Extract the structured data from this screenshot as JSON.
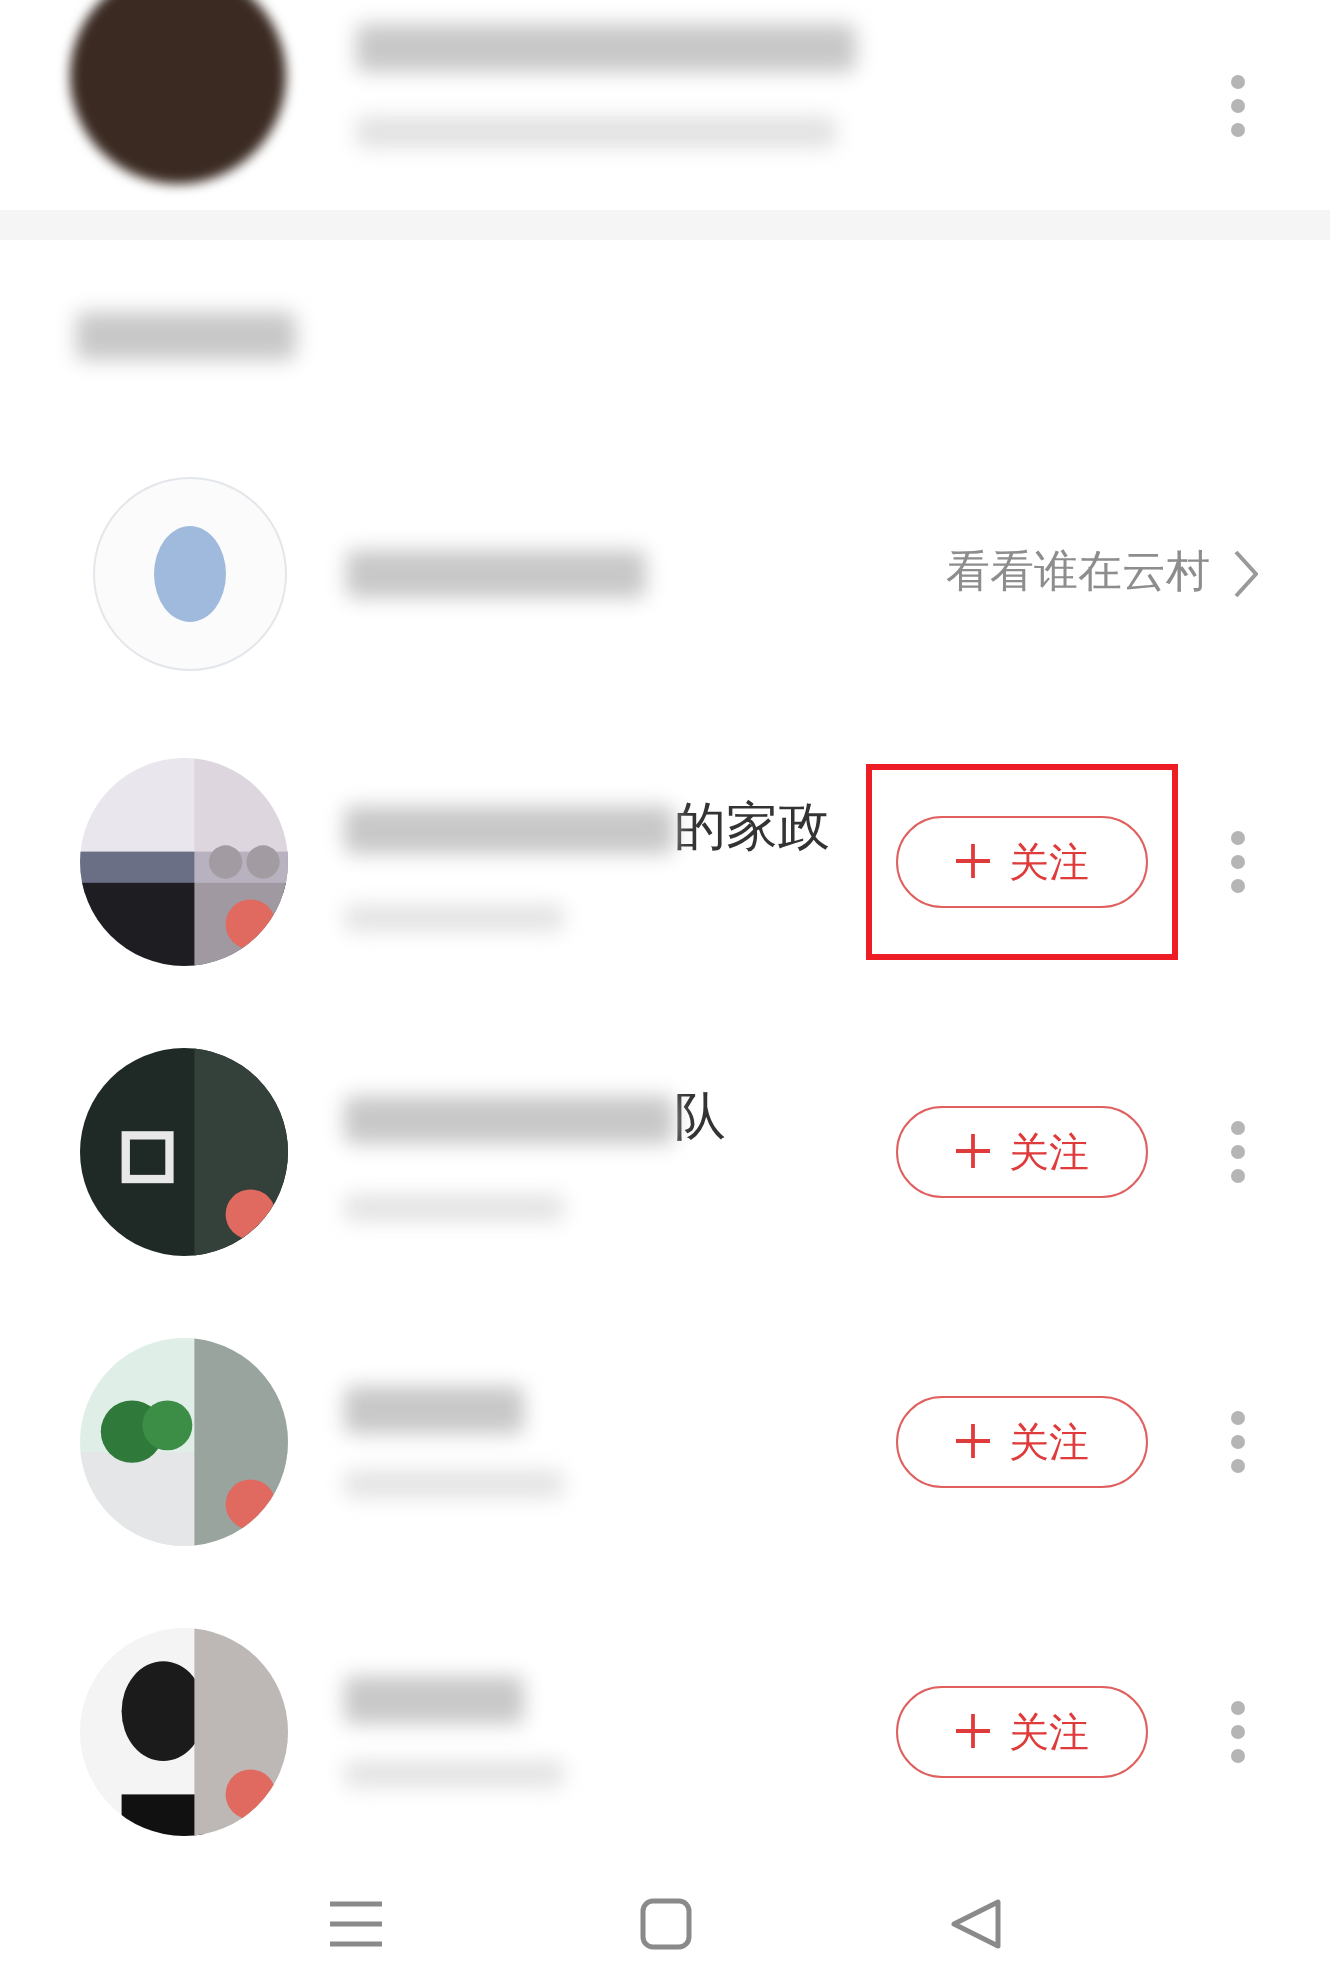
{
  "suggestion": {
    "link": "看看谁在云村"
  },
  "users": [
    {
      "name_visible": "的家政",
      "follow": "关注",
      "highlighted": true
    },
    {
      "name_visible": "队",
      "follow": "关注",
      "highlighted": false
    },
    {
      "follow": "关注",
      "highlighted": false
    },
    {
      "follow": "关注",
      "highlighted": false
    }
  ]
}
